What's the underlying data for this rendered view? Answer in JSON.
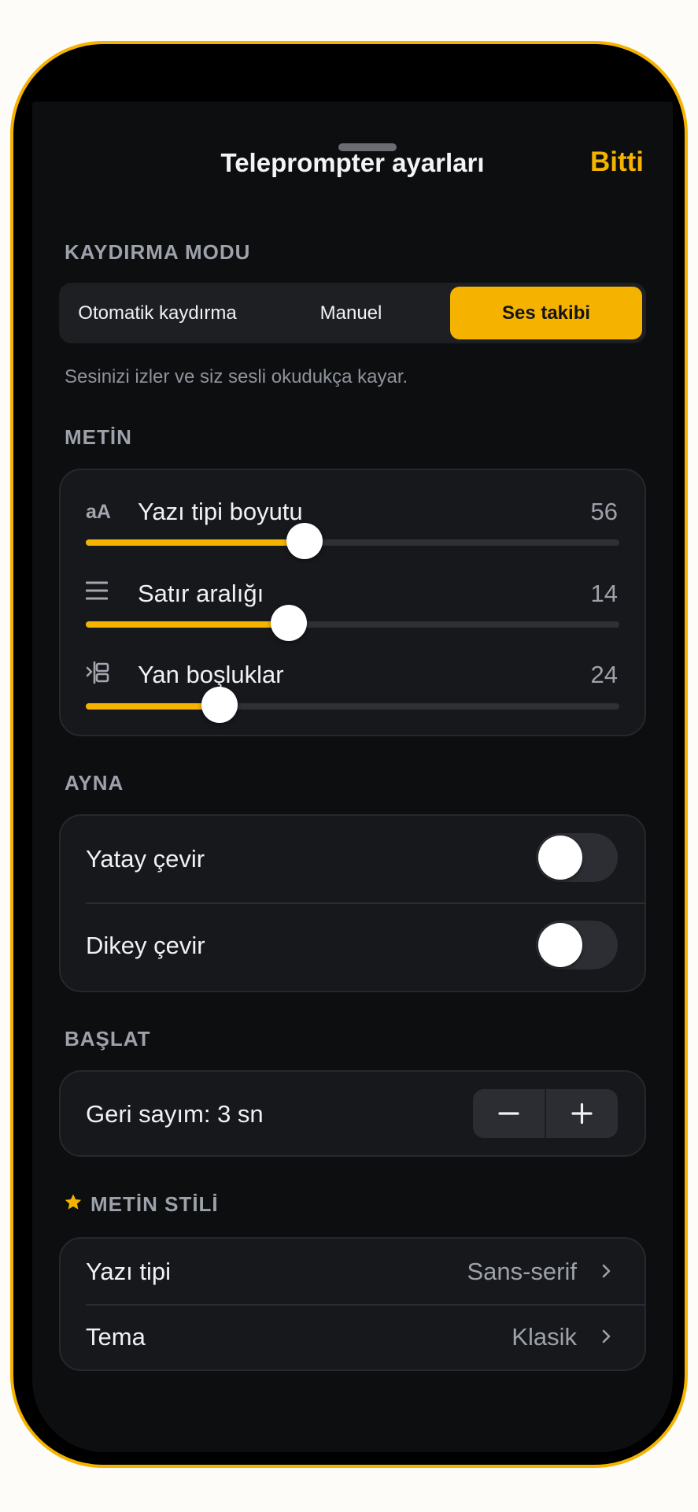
{
  "header": {
    "title": "Teleprompter ayarları",
    "done_label": "Bitti"
  },
  "scroll_mode": {
    "section_title": "KAYDIRMA MODU",
    "options": [
      "Otomatik kaydırma",
      "Manuel",
      "Ses takibi"
    ],
    "selected": "Ses takibi",
    "helper": "Sesinizi izler ve siz sesli okudukça kayar."
  },
  "text": {
    "section_title": "METİN",
    "sliders": [
      {
        "icon": "font-size-icon",
        "icon_text": "aA",
        "label": "Yazı tipi boyutu",
        "value": "56",
        "fill_fraction": 0.41
      },
      {
        "icon": "line-spacing-icon",
        "label": "Satır aralığı",
        "value": "14",
        "fill_fraction": 0.38
      },
      {
        "icon": "side-margins-icon",
        "label": "Yan boşluklar",
        "value": "24",
        "fill_fraction": 0.25
      }
    ]
  },
  "mirror": {
    "section_title": "AYNA",
    "horizontal_label": "Yatay çevir",
    "horizontal_on": false,
    "vertical_label": "Dikey çevir",
    "vertical_on": false
  },
  "start": {
    "section_title": "BAŞLAT",
    "countdown_label": "Geri sayım: 3 sn",
    "minus_label": "−",
    "plus_label": "+"
  },
  "text_style": {
    "section_title": "METİN STİLİ",
    "font_label": "Yazı tipi",
    "font_value": "Sans-serif",
    "theme_label": "Tema",
    "theme_value": "Klasik"
  },
  "colors": {
    "accent": "#F5B300",
    "background": "#0D0E10",
    "card": "#17181C"
  }
}
